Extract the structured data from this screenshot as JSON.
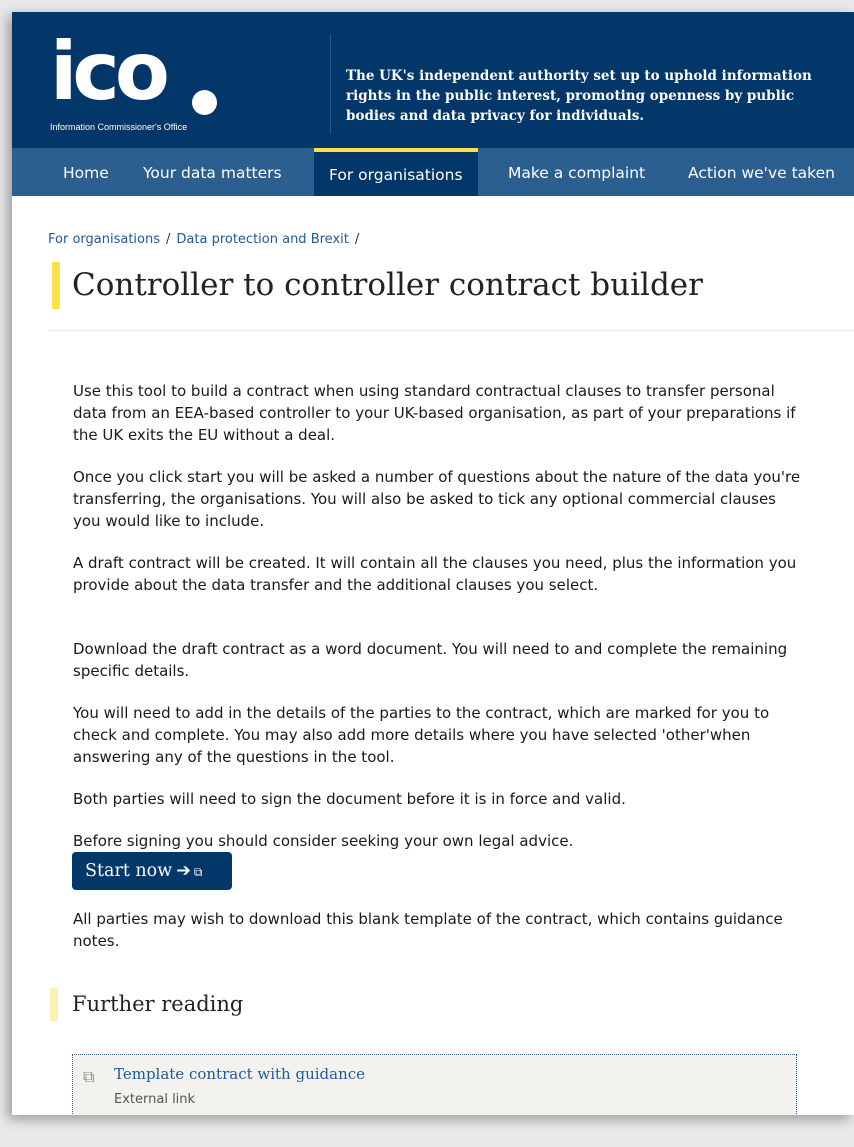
{
  "header": {
    "logo_text": "ico",
    "logo_subtitle": "Information Commissioner's Office",
    "tagline": "The UK's independent authority set up to uphold information rights in the public interest, promoting openness by public bodies and data privacy for individuals."
  },
  "nav": {
    "items": [
      {
        "label": "Home"
      },
      {
        "label": "Your data matters"
      },
      {
        "label": "For organisations"
      },
      {
        "label": "Make a complaint"
      },
      {
        "label": "Action we've taken"
      }
    ],
    "active": "For organisations"
  },
  "breadcrumb": {
    "items": [
      "For organisations",
      "Data protection and Brexit"
    ],
    "separator": "/"
  },
  "page": {
    "title": "Controller to controller contract builder",
    "paragraphs": [
      "Use this tool to build a contract when using standard contractual clauses to transfer personal data from an EEA-based controller to your UK-based organisation, as part of your preparations if the UK exits the EU without a deal.",
      "Once you click start you will be asked a number of questions about the nature of the data you're transferring, the organisations. You will also be asked to tick any optional commercial clauses you would like to include.",
      "A draft contract will be created. It will contain all the clauses you need, plus the information you provide about the data transfer and the additional clauses you select.",
      "Download the draft contract as a word document. You will need to and complete the remaining specific details.",
      "You will need to add in the details of the parties to the contract, which are marked for you to check and complete. You may also add more details where you have selected 'other'when answering any of the questions in the tool.",
      "Both parties will need to sign the document before it is in force and valid.",
      "Before signing you should consider seeking your own legal advice."
    ],
    "start_button": {
      "label": "Start now",
      "arrow": "➔",
      "ext_icon": "external-link-icon"
    },
    "template_note": " All parties may wish to download this blank template of the contract, which contains guidance notes."
  },
  "further_reading": {
    "title": "Further reading",
    "links": [
      {
        "title": "Template contract with guidance",
        "subtitle": "External link",
        "icon": "external-link-icon"
      }
    ]
  },
  "colors": {
    "masthead": "#033669",
    "nav": "#2b5f8f",
    "accent_yellow": "#fde04a",
    "link": "#1f5a9a"
  }
}
